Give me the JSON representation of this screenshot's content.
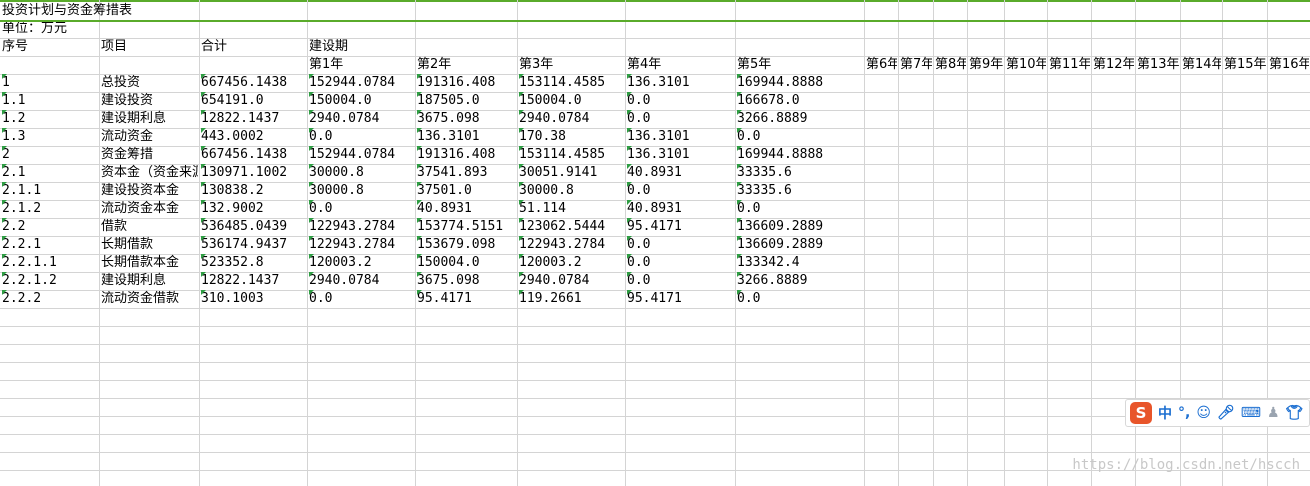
{
  "sheet": {
    "title": "投资计划与资金筹措表",
    "unit": "单位：万元",
    "headers": {
      "seq": "序号",
      "item": "项目",
      "total": "合计",
      "construction": "建设期",
      "years": [
        "第1年",
        "第2年",
        "第3年",
        "第4年",
        "第5年",
        "第6年",
        "第7年",
        "第8年",
        "第9年",
        "第10年",
        "第11年",
        "第12年",
        "第13年",
        "第14年",
        "第15年",
        "第16年"
      ]
    },
    "rows": [
      {
        "seq": "1",
        "item": "总投资",
        "total": "667456.1438",
        "y1": "152944.0784",
        "y2": "191316.408",
        "y3": "153114.4585",
        "y4": "136.3101",
        "y5": "169944.8888"
      },
      {
        "seq": "1.1",
        "item": "建设投资",
        "total": "654191.0",
        "y1": "150004.0",
        "y2": "187505.0",
        "y3": "150004.0",
        "y4": "0.0",
        "y5": "166678.0"
      },
      {
        "seq": "1.2",
        "item": "建设期利息",
        "total": "12822.1437",
        "y1": "2940.0784",
        "y2": "3675.098",
        "y3": "2940.0784",
        "y4": "0.0",
        "y5": "3266.8889"
      },
      {
        "seq": "1.3",
        "item": "流动资金",
        "total": "443.0002",
        "y1": "0.0",
        "y2": "136.3101",
        "y3": "170.38",
        "y4": "136.3101",
        "y5": "0.0"
      },
      {
        "seq": "2",
        "item": "资金筹措",
        "total": "667456.1438",
        "y1": "152944.0784",
        "y2": "191316.408",
        "y3": "153114.4585",
        "y4": "136.3101",
        "y5": "169944.8888"
      },
      {
        "seq": "2.1",
        "item": "资本金（资金来源",
        "total": "130971.1002",
        "y1": "30000.8",
        "y2": "37541.893",
        "y3": "30051.9141",
        "y4": "40.8931",
        "y5": "33335.6"
      },
      {
        "seq": "2.1.1",
        "item": "建设投资本金",
        "total": "130838.2",
        "y1": "30000.8",
        "y2": "37501.0",
        "y3": "30000.8",
        "y4": "0.0",
        "y5": "33335.6"
      },
      {
        "seq": "2.1.2",
        "item": "流动资金本金",
        "total": "132.9002",
        "y1": "0.0",
        "y2": "40.8931",
        "y3": "51.114",
        "y4": "40.8931",
        "y5": "0.0"
      },
      {
        "seq": "2.2",
        "item": "借款",
        "total": "536485.0439",
        "y1": "122943.2784",
        "y2": "153774.5151",
        "y3": "123062.5444",
        "y4": "95.4171",
        "y5": "136609.2889"
      },
      {
        "seq": "2.2.1",
        "item": "长期借款",
        "total": "536174.9437",
        "y1": "122943.2784",
        "y2": "153679.098",
        "y3": "122943.2784",
        "y4": "0.0",
        "y5": "136609.2889"
      },
      {
        "seq": "2.2.1.1",
        "item": "长期借款本金",
        "total": "523352.8",
        "y1": "120003.2",
        "y2": "150004.0",
        "y3": "120003.2",
        "y4": "0.0",
        "y5": "133342.4"
      },
      {
        "seq": "2.2.1.2",
        "item": "建设期利息",
        "total": "12822.1437",
        "y1": "2940.0784",
        "y2": "3675.098",
        "y3": "2940.0784",
        "y4": "0.0",
        "y5": "3266.8889"
      },
      {
        "seq": "2.2.2",
        "item": "流动资金借款",
        "total": "310.1003",
        "y1": "0.0",
        "y2": "95.4171",
        "y3": "119.2661",
        "y4": "95.4171",
        "y5": "0.0"
      }
    ]
  },
  "ime": {
    "logo": "S",
    "lang": "中",
    "punct": "°,",
    "icons": [
      "smiley-icon",
      "microphone-icon",
      "keyboard-icon",
      "user-icon",
      "shirt-icon"
    ]
  },
  "watermark": "https://blog.csdn.net/hscch"
}
